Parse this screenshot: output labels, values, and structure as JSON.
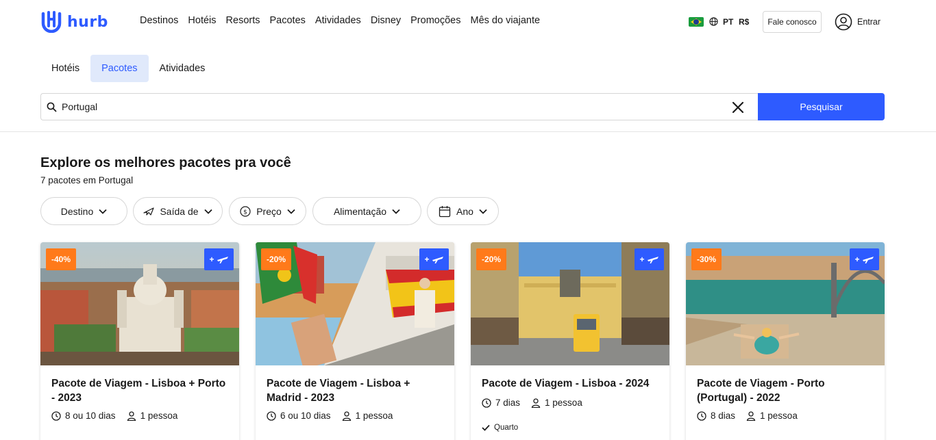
{
  "header": {
    "brand": "hurb",
    "nav": [
      "Destinos",
      "Hotéis",
      "Resorts",
      "Pacotes",
      "Atividades",
      "Disney",
      "Promoções",
      "Mês do viajante"
    ],
    "language": "PT",
    "currency": "R$",
    "contact_label": "Fale conosco",
    "login_label": "Entrar"
  },
  "tabs": [
    {
      "label": "Hotéis",
      "active": false
    },
    {
      "label": "Pacotes",
      "active": true
    },
    {
      "label": "Atividades",
      "active": false
    }
  ],
  "search": {
    "value": "Portugal",
    "button_label": "Pesquisar"
  },
  "results": {
    "title": "Explore os melhores pacotes pra você",
    "count_text": "7 pacotes em Portugal"
  },
  "filters": {
    "destino": "Destino",
    "saida": "Saída de",
    "preco": "Preço",
    "alimentacao": "Alimentação",
    "ano": "Ano"
  },
  "cards": [
    {
      "discount": "-40%",
      "flight_badge": "+",
      "title": "Pacote de Viagem - Lisboa + Porto - 2023",
      "duration": "8 ou 10 dias",
      "people": "1 pessoa"
    },
    {
      "discount": "-20%",
      "flight_badge": "+",
      "title": "Pacote de Viagem - Lisboa + Madrid - 2023",
      "duration": "6 ou 10 dias",
      "people": "1 pessoa"
    },
    {
      "discount": "-20%",
      "flight_badge": "+",
      "title": "Pacote de Viagem - Lisboa - 2024",
      "duration": "7 dias",
      "people": "1 pessoa",
      "amenity": "Quarto"
    },
    {
      "discount": "-30%",
      "flight_badge": "+",
      "title": "Pacote de Viagem - Porto (Portugal) - 2022",
      "duration": "8 dias",
      "people": "1 pessoa"
    }
  ],
  "colors": {
    "brand_blue": "#2e5bff",
    "discount_orange": "#ff7a1a",
    "active_tab_bg": "#e0e9fb"
  }
}
